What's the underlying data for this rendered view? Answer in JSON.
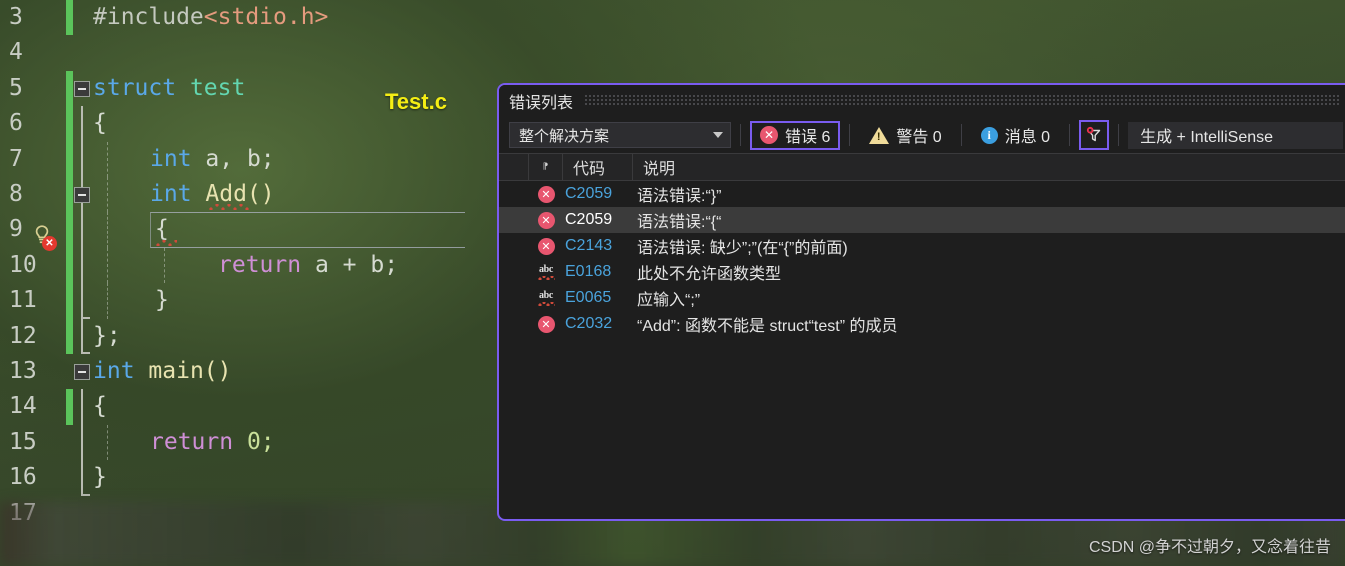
{
  "editor": {
    "file_label": "Test.c",
    "lines": [
      {
        "num": "3",
        "text": "#include<stdio.h>"
      },
      {
        "num": "4",
        "text": ""
      },
      {
        "num": "5",
        "text": "struct test"
      },
      {
        "num": "6",
        "text": "{"
      },
      {
        "num": "7",
        "text": "int a, b;"
      },
      {
        "num": "8",
        "text": "int Add()"
      },
      {
        "num": "9",
        "text": "{"
      },
      {
        "num": "10",
        "text": "return a + b;"
      },
      {
        "num": "11",
        "text": "}"
      },
      {
        "num": "12",
        "text": "};"
      },
      {
        "num": "13",
        "text": "int main()"
      },
      {
        "num": "14",
        "text": "{"
      },
      {
        "num": "15",
        "text": "return 0;"
      },
      {
        "num": "16",
        "text": "}"
      },
      {
        "num": "17",
        "text": ""
      }
    ],
    "tokens": {
      "preproc": "#include",
      "header": "<stdio.h>",
      "struct_kw": "struct",
      "struct_name": "test",
      "brace_open": "{",
      "brace_close": "}",
      "int_kw": "int",
      "members": "a, b;",
      "fn_name": "Add()",
      "return_kw": "return",
      "return_expr": "a + b;",
      "close_semi": "};",
      "main_name": "main()",
      "zero_semi": "0;"
    }
  },
  "error_panel": {
    "title": "错误列表",
    "scope_filter": {
      "value": "整个解决方案"
    },
    "counters": {
      "errors_label": "错误 6",
      "warnings_label": "警告 0",
      "messages_label": "消息 0"
    },
    "filter_icon_name": "filter-funnel-icon",
    "build_scope": "生成 + IntelliSense",
    "columns": {
      "icon": "",
      "code": "代码",
      "description": "说明"
    },
    "rows": [
      {
        "severity": "error",
        "code": "C2059",
        "description": "语法错误:“}”",
        "selected": false
      },
      {
        "severity": "error",
        "code": "C2059",
        "description": "语法错误:“{“",
        "selected": true
      },
      {
        "severity": "error",
        "code": "C2143",
        "description": "语法错误: 缺少”;”(在“{”的前面)",
        "selected": false
      },
      {
        "severity": "intellisense",
        "code": "E0168",
        "description": "此处不允许函数类型",
        "selected": false
      },
      {
        "severity": "intellisense",
        "code": "E0065",
        "description": "应输入“;”",
        "selected": false
      },
      {
        "severity": "error",
        "code": "C2032",
        "description": "“Add”: 函数不能是 struct“test” 的成员",
        "selected": false
      }
    ]
  },
  "watermark": "CSDN @争不过朝夕，又念着往昔",
  "colors": {
    "panel_border": "#7a5cf0",
    "panel_bg": "#1e1e1e",
    "error_red": "#e8566f",
    "warning_yellow": "#f0dc9a",
    "info_blue": "#3b9fe0",
    "code_link_blue": "#4aa3dc",
    "file_label_yellow": "#f5ee14",
    "changebar_green": "#5bc45b"
  }
}
